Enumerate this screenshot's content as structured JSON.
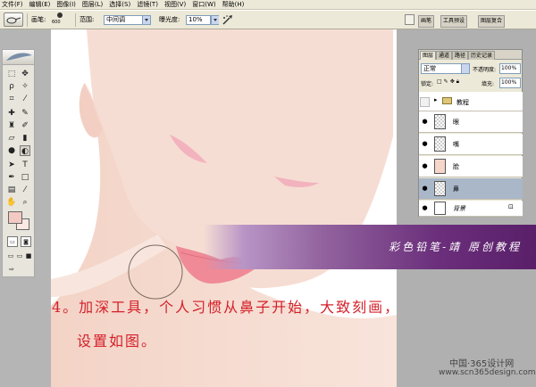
{
  "menu": [
    "文件(F)",
    "编辑(E)",
    "图像(I)",
    "图层(L)",
    "选择(S)",
    "滤镜(T)",
    "视图(V)",
    "窗口(W)",
    "帮助(H)"
  ],
  "options": {
    "brush_label": "画笔:",
    "brush_size": "600",
    "range_label": "范围:",
    "range_value": "中间调",
    "exposure_label": "曝光度:",
    "exposure_value": "10%"
  },
  "wells": [
    "画笔",
    "工具预设",
    "图层复合"
  ],
  "layers_panel": {
    "tabs": [
      "图层",
      "通道",
      "路径",
      "历史记录"
    ],
    "blend_mode": "正常",
    "opacity_label": "不透明度:",
    "opacity_value": "100%",
    "lock_label": "锁定:",
    "fill_label": "填充:",
    "fill_value": "100%",
    "layers": [
      {
        "name": "教程",
        "visible": false,
        "type": "group"
      },
      {
        "name": "眼",
        "visible": true,
        "type": "layer"
      },
      {
        "name": "嘴",
        "visible": true,
        "type": "layer"
      },
      {
        "name": "脸",
        "visible": true,
        "type": "layer"
      },
      {
        "name": "鼻",
        "visible": true,
        "type": "layer",
        "selected": true
      },
      {
        "name": "背景",
        "visible": true,
        "type": "background"
      }
    ]
  },
  "banner_text": "彩色铅笔-靖 原创教程",
  "instruction_line1": "4。加深工具，个人习惯从鼻子开始，大致刻画，",
  "instruction_line2": "设置如图。",
  "watermark_line1": "中国·365设计网",
  "watermark_line2": "www.scn365design.com",
  "colors": {
    "skin": "#f6ddd3",
    "lip": "#ef8a96",
    "eye": "#f2b3be",
    "banner_dark": "#5a1f69",
    "instruction": "#d4202a",
    "foreground_swatch": "#f3c9c4"
  }
}
